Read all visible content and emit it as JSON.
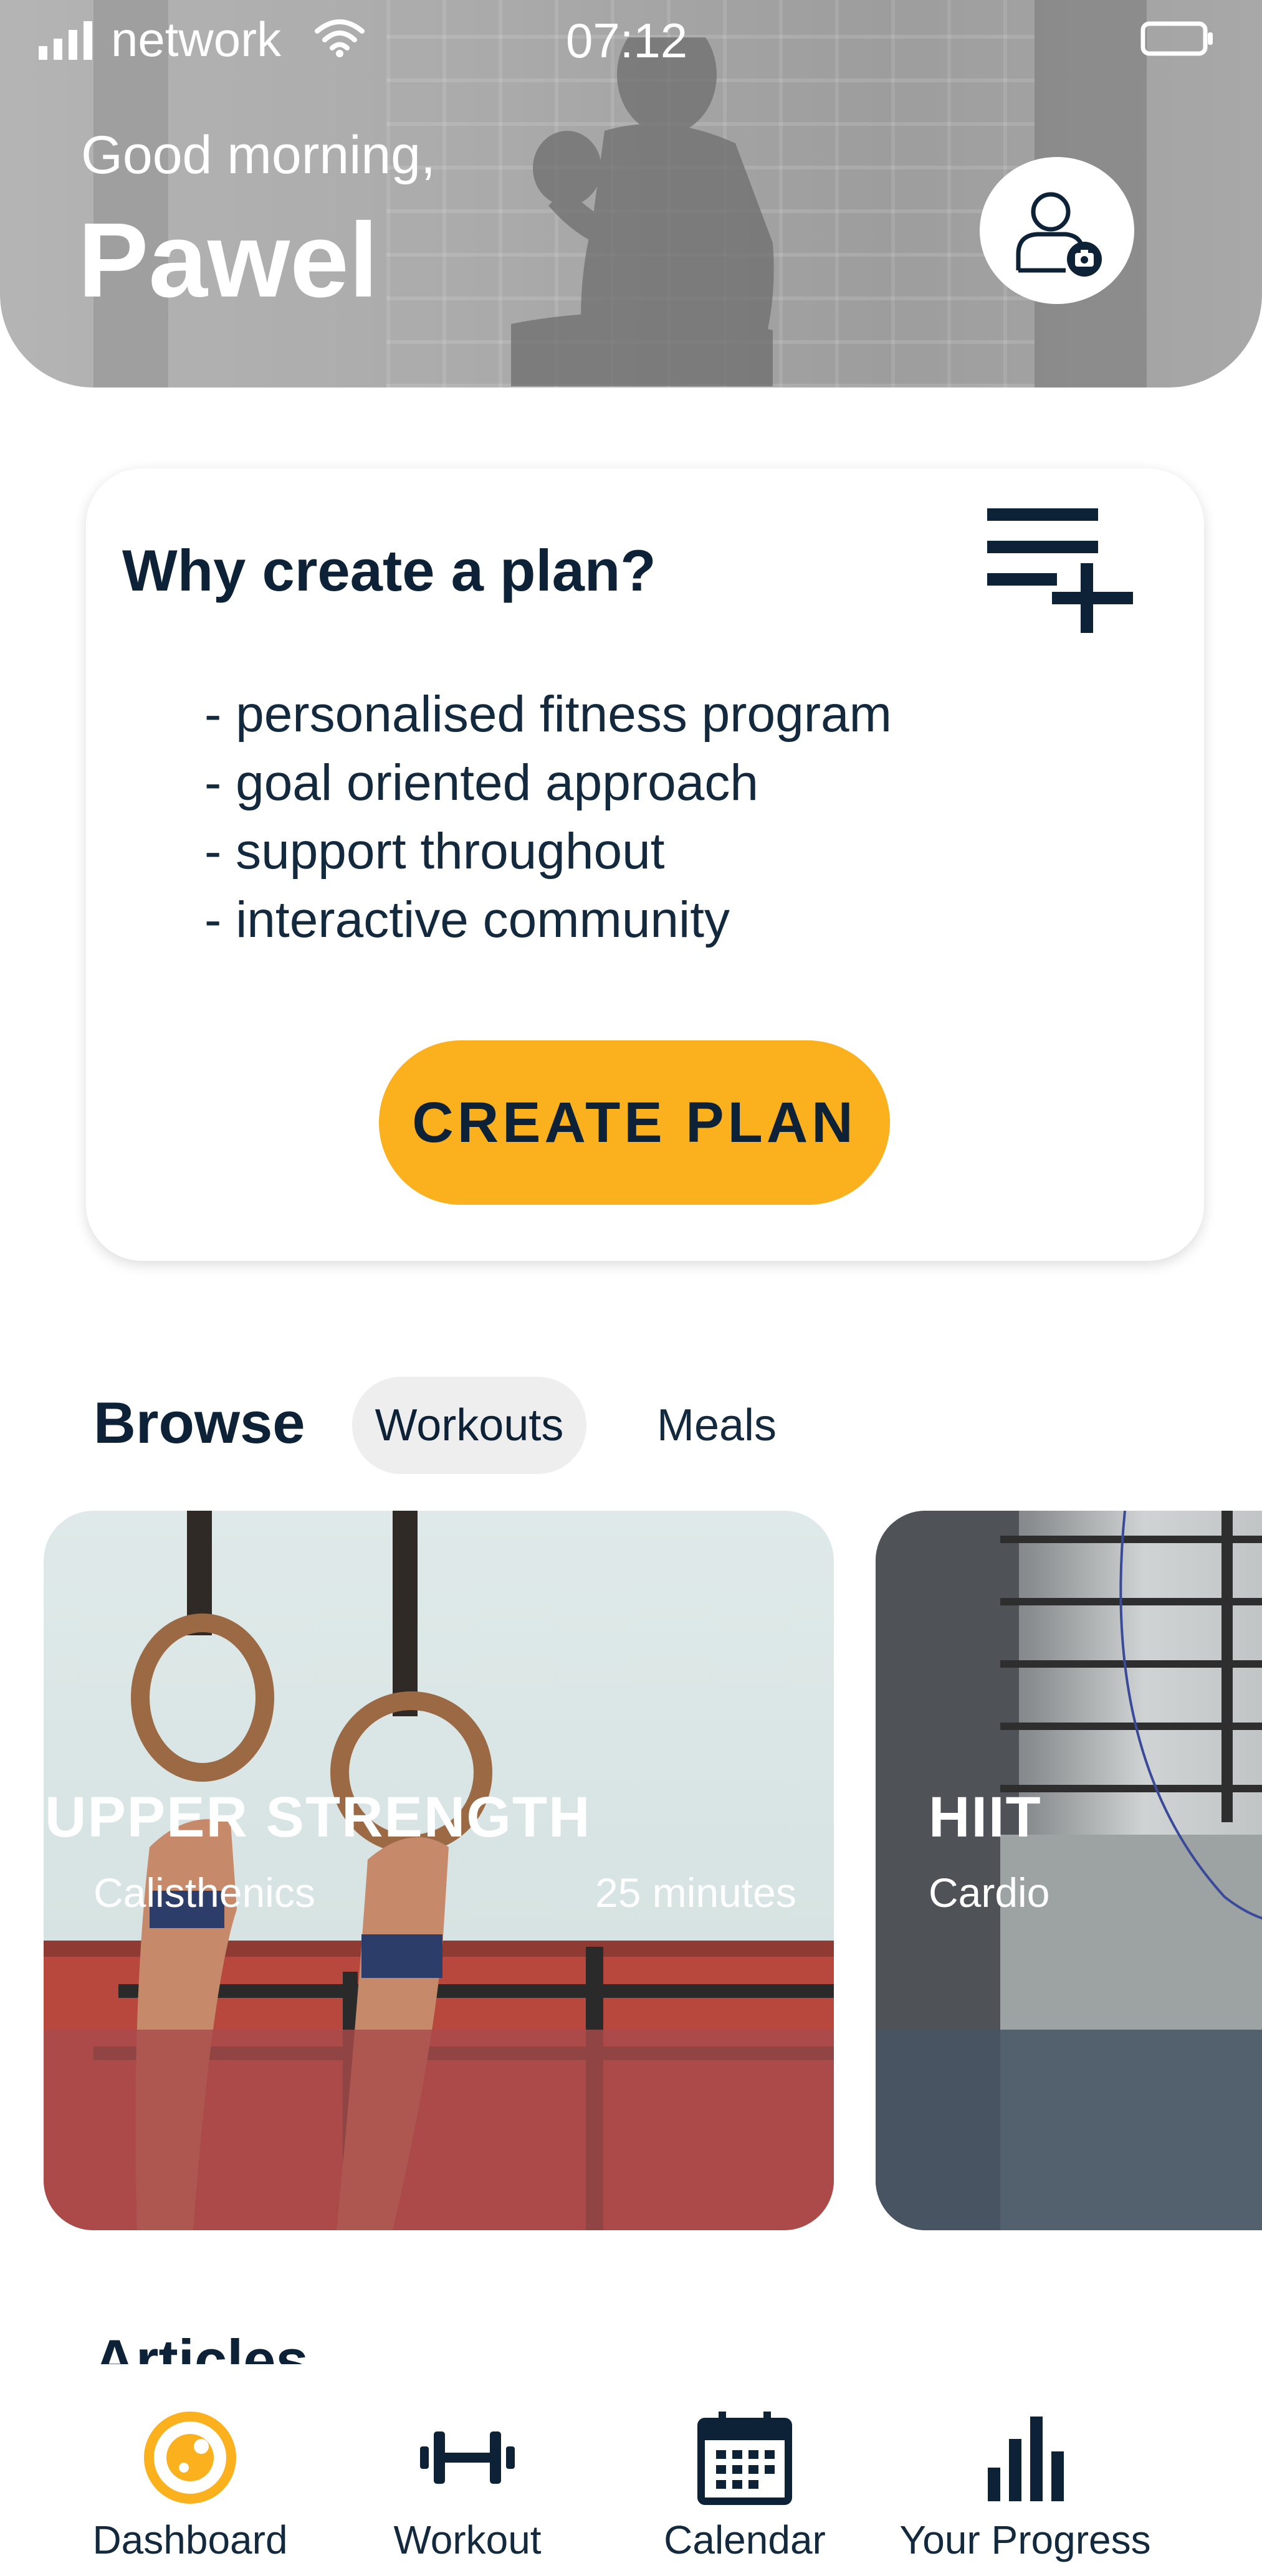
{
  "status_bar": {
    "network": "network",
    "time": "07:12"
  },
  "header": {
    "greeting": "Good morning,",
    "user_name": "Pawel"
  },
  "plan_card": {
    "title": "Why create a plan?",
    "benefits": [
      "- personalised fitness program",
      "- goal oriented approach",
      "- support throughout",
      "- interactive community"
    ],
    "button_label": "CREATE PLAN"
  },
  "browse": {
    "title": "Browse",
    "tabs": [
      {
        "label": "Workouts",
        "active": true
      },
      {
        "label": "Meals",
        "active": false
      }
    ],
    "cards": [
      {
        "title": "UPPER STRENGTH",
        "category": "Calisthenics",
        "duration": "25 minutes"
      },
      {
        "title": "HIIT",
        "category": "Cardio"
      }
    ]
  },
  "articles": {
    "title": "Articles"
  },
  "bottom_nav": {
    "items": [
      {
        "label": "Dashboard",
        "icon": "dashboard-icon",
        "active": true
      },
      {
        "label": "Workout",
        "icon": "dumbbell-icon",
        "active": false
      },
      {
        "label": "Calendar",
        "icon": "calendar-icon",
        "active": false
      },
      {
        "label": "Your Progress",
        "icon": "bar-chart-icon",
        "active": false
      }
    ]
  },
  "colors": {
    "accent": "#fbb01e",
    "text_dark": "#0d2236",
    "tab_bg": "#eeeeee"
  }
}
